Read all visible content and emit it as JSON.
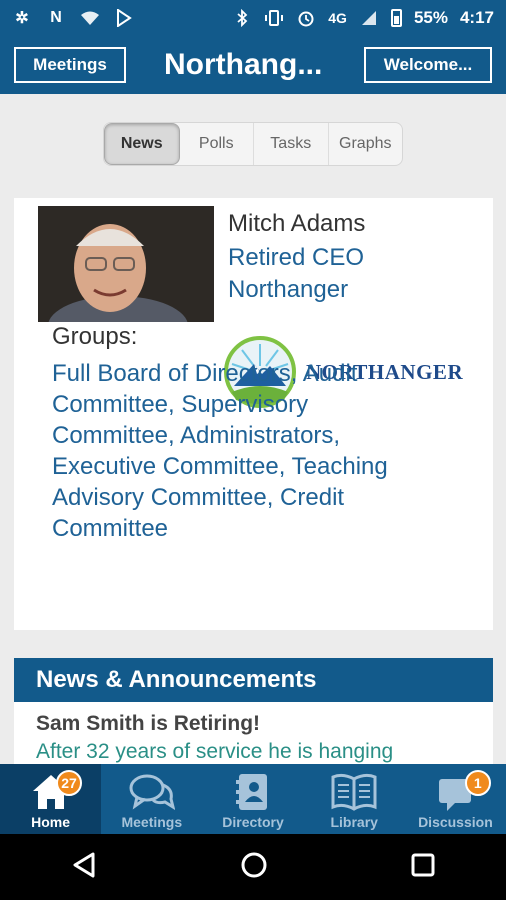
{
  "status_bar": {
    "network": "4G",
    "battery": "55%",
    "time": "4:17"
  },
  "header": {
    "left_button": "Meetings",
    "title": "Northang...",
    "right_button": "Welcome..."
  },
  "tabs": [
    {
      "label": "News",
      "active": true
    },
    {
      "label": "Polls",
      "active": false
    },
    {
      "label": "Tasks",
      "active": false
    },
    {
      "label": "Graphs",
      "active": false
    }
  ],
  "profile": {
    "name": "Mitch Adams",
    "role": "Retired CEO",
    "organization": "Northanger",
    "groups_label": "Groups:",
    "groups_text": "Full Board of Directors, Audit Committee, Supervisory Committee, Administrators, Executive Committee, Teaching Advisory Committee, Credit Committee",
    "logo_text": "NORTHANGER"
  },
  "news": {
    "header": "News & Announcements",
    "items": [
      {
        "title": "Sam Smith is Retiring!",
        "snippet": "After 32 years of service he is hanging"
      }
    ]
  },
  "bottom_nav": [
    {
      "label": "Home",
      "icon": "home-icon",
      "badge": "27",
      "active": true
    },
    {
      "label": "Meetings",
      "icon": "chat-bubbles-icon",
      "badge": "",
      "active": false
    },
    {
      "label": "Directory",
      "icon": "contact-book-icon",
      "badge": "",
      "active": false
    },
    {
      "label": "Library",
      "icon": "open-book-icon",
      "badge": "",
      "active": false
    },
    {
      "label": "Discussion",
      "icon": "discussion-bubble-icon",
      "badge": "1",
      "active": false
    }
  ],
  "colors": {
    "brand_blue": "#125a8b",
    "link_blue": "#1f6296",
    "badge_orange": "#f08a1c",
    "snippet_teal": "#2a8f86"
  }
}
